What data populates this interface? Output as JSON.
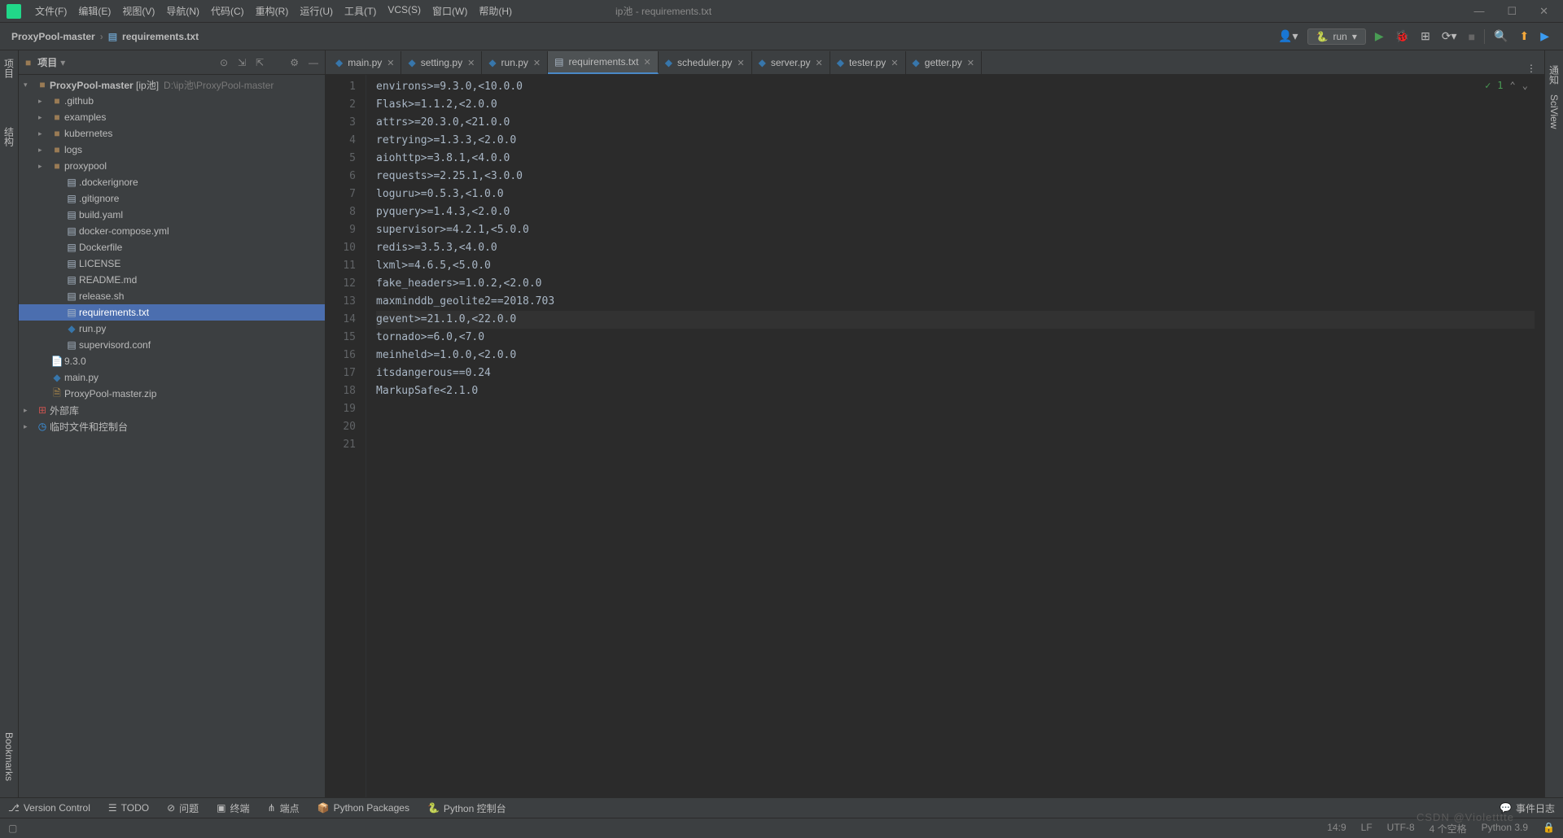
{
  "window_title": "ip池 - requirements.txt",
  "menu": [
    "文件(F)",
    "编辑(E)",
    "视图(V)",
    "导航(N)",
    "代码(C)",
    "重构(R)",
    "运行(U)",
    "工具(T)",
    "VCS(S)",
    "窗口(W)",
    "帮助(H)"
  ],
  "breadcrumb": {
    "project": "ProxyPool-master",
    "file": "requirements.txt"
  },
  "run_config": "run",
  "sidebar": {
    "title": "项目",
    "root": {
      "name": "ProxyPool-master",
      "alias": "[ip池]",
      "path": "D:\\ip池\\ProxyPool-master"
    },
    "folders": [
      ".github",
      "examples",
      "kubernetes",
      "logs",
      "proxypool"
    ],
    "files": [
      ".dockerignore",
      ".gitignore",
      "build.yaml",
      "docker-compose.yml",
      "Dockerfile",
      "LICENSE",
      "README.md",
      "release.sh",
      "requirements.txt",
      "run.py",
      "supervisord.conf"
    ],
    "selected": "requirements.txt",
    "scratches": [
      "9.3.0",
      "main.py",
      "ProxyPool-master.zip"
    ],
    "libs": "外部库",
    "temp": "临时文件和控制台"
  },
  "tabs": [
    {
      "name": "main.py",
      "type": "py"
    },
    {
      "name": "setting.py",
      "type": "py"
    },
    {
      "name": "run.py",
      "type": "py"
    },
    {
      "name": "requirements.txt",
      "type": "txt",
      "active": true
    },
    {
      "name": "scheduler.py",
      "type": "py"
    },
    {
      "name": "server.py",
      "type": "py"
    },
    {
      "name": "tester.py",
      "type": "py"
    },
    {
      "name": "getter.py",
      "type": "py"
    }
  ],
  "chart_data": {
    "type": "table",
    "title": "requirements.txt",
    "columns": [
      "line",
      "content"
    ],
    "rows": [
      [
        1,
        "environs>=9.3.0,<10.0.0"
      ],
      [
        2,
        "Flask>=1.1.2,<2.0.0"
      ],
      [
        3,
        "attrs>=20.3.0,<21.0.0"
      ],
      [
        4,
        "retrying>=1.3.3,<2.0.0"
      ],
      [
        5,
        "aiohttp>=3.8.1,<4.0.0"
      ],
      [
        6,
        "requests>=2.25.1,<3.0.0"
      ],
      [
        7,
        "loguru>=0.5.3,<1.0.0"
      ],
      [
        8,
        "pyquery>=1.4.3,<2.0.0"
      ],
      [
        9,
        "supervisor>=4.2.1,<5.0.0"
      ],
      [
        10,
        "redis>=3.5.3,<4.0.0"
      ],
      [
        11,
        "lxml>=4.6.5,<5.0.0"
      ],
      [
        12,
        "fake_headers>=1.0.2,<2.0.0"
      ],
      [
        13,
        "maxminddb_geolite2==2018.703"
      ],
      [
        14,
        "gevent>=21.1.0,<22.0.0"
      ],
      [
        15,
        "tornado>=6.0,<7.0"
      ],
      [
        16,
        "meinheld>=1.0.0,<2.0.0"
      ],
      [
        17,
        "itsdangerous==0.24"
      ],
      [
        18,
        "MarkupSafe<2.1.0"
      ],
      [
        19,
        ""
      ],
      [
        20,
        ""
      ],
      [
        21,
        ""
      ]
    ]
  },
  "current_line": 14,
  "inspection": {
    "icon": "✓",
    "count": "1"
  },
  "right_tools": [
    "通知",
    "SciView"
  ],
  "left_tools": [
    "项目",
    "结构",
    "Bookmarks"
  ],
  "bottom_tools": [
    "Version Control",
    "TODO",
    "问题",
    "终端",
    "端点",
    "Python Packages",
    "Python 控制台"
  ],
  "bottom_right": "事件日志",
  "status": {
    "pos": "14:9",
    "eol": "LF",
    "enc": "UTF-8",
    "indent": "4 个空格",
    "sdk": "Python 3.9"
  },
  "watermark": "CSDN @Violetttte"
}
